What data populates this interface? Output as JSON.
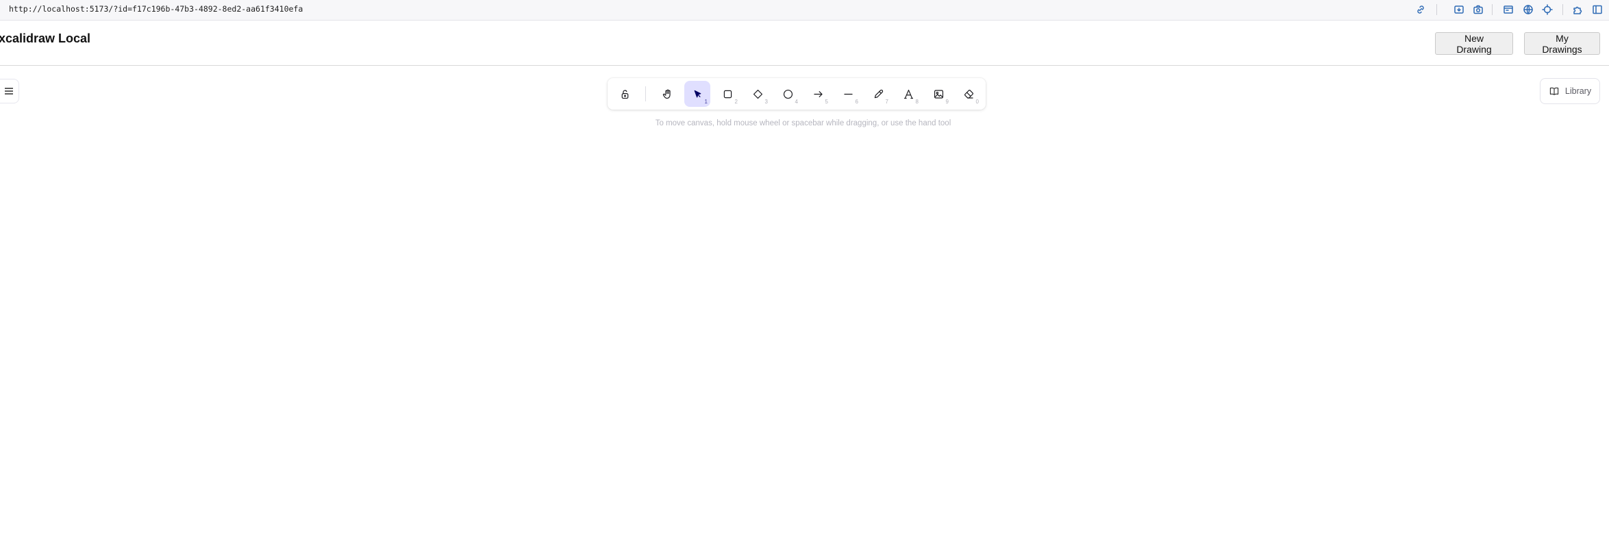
{
  "browser": {
    "url": "http://localhost:5173/?id=f17c196b-47b3-4892-8ed2-aa61f3410efa",
    "extension_icons": [
      "link-icon",
      "screen-record-icon",
      "camera-icon",
      "window-icon",
      "globe-icon",
      "crosshair-icon",
      "puzzle-icon",
      "sidebar-icon"
    ]
  },
  "header": {
    "title": "xcalidraw Local",
    "new_drawing_label": "New Drawing",
    "my_drawings_label": "My Drawings"
  },
  "toolbar": {
    "tools": [
      {
        "name": "lock",
        "key": ""
      },
      {
        "name": "hand",
        "key": ""
      },
      {
        "name": "selection",
        "key": "1",
        "active": true
      },
      {
        "name": "rectangle",
        "key": "2"
      },
      {
        "name": "diamond",
        "key": "3"
      },
      {
        "name": "ellipse",
        "key": "4"
      },
      {
        "name": "arrow",
        "key": "5"
      },
      {
        "name": "line",
        "key": "6"
      },
      {
        "name": "draw",
        "key": "7"
      },
      {
        "name": "text",
        "key": "8"
      },
      {
        "name": "image",
        "key": "9"
      },
      {
        "name": "eraser",
        "key": "0"
      }
    ],
    "hint": "To move canvas, hold mouse wheel or spacebar while dragging, or use the hand tool"
  },
  "library": {
    "label": "Library"
  },
  "colors": {
    "active_tool_bg": "#e0dfff",
    "accent": "#6965db"
  }
}
